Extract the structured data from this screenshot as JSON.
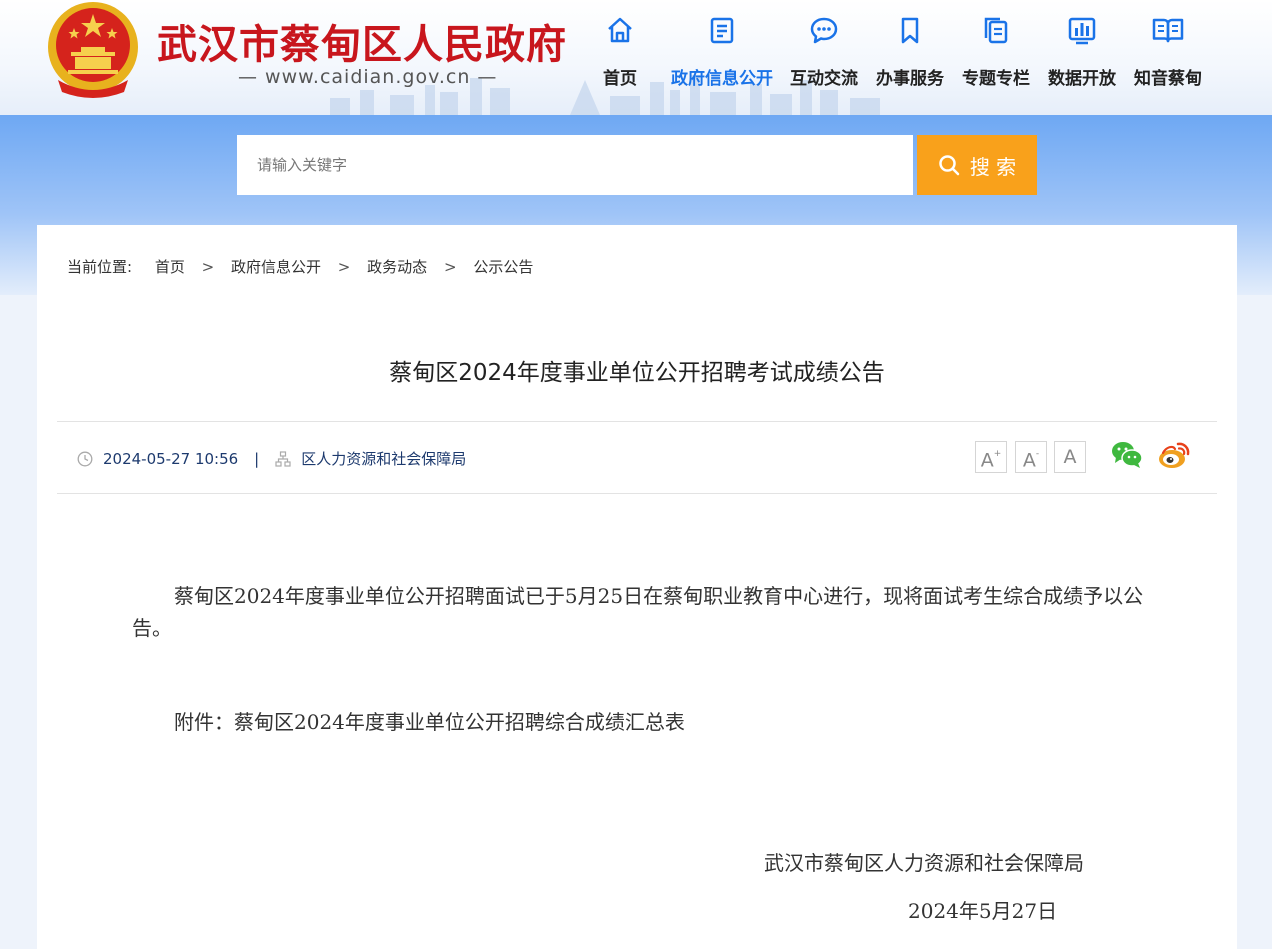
{
  "header": {
    "site_title": "武汉市蔡甸区人民政府",
    "site_url": "— www.caidian.gov.cn —"
  },
  "nav": {
    "items": [
      {
        "label": "首页",
        "icon": "home-icon"
      },
      {
        "label": "政府信息公开",
        "icon": "document-icon",
        "active": true
      },
      {
        "label": "互动交流",
        "icon": "chat-bubble-icon"
      },
      {
        "label": "办事服务",
        "icon": "bookmark-icon"
      },
      {
        "label": "专题专栏",
        "icon": "stacked-pages-icon"
      },
      {
        "label": "数据开放",
        "icon": "bar-chart-icon"
      },
      {
        "label": "知音蔡甸",
        "icon": "open-book-icon"
      }
    ],
    "active_color": "#1a73e8"
  },
  "search": {
    "placeholder": "请输入关键字",
    "button_label": "搜 索",
    "button_color": "#f9a11b"
  },
  "breadcrumb": {
    "lead": "当前位置:",
    "items": [
      "首页",
      "政务动态",
      "政府信息公开",
      "公示公告"
    ],
    "separator": ">"
  },
  "article": {
    "title": "蔡甸区2024年度事业单位公开招聘考试成绩公告",
    "datetime": "2024-05-27 10:56",
    "source": "区人力资源和社会保障局",
    "paragraph_1": "蔡甸区2024年度事业单位公开招聘面试已于5月25日在蔡甸职业教育中心进行，现将面试考生综合成绩予以公告。",
    "paragraph_2": "附件：蔡甸区2024年度事业单位公开招聘综合成绩汇总表",
    "signature_org": "武汉市蔡甸区人力资源和社会保障局",
    "signature_date": "2024年5月27日"
  },
  "font_size_controls": {
    "increase": "A",
    "decrease": "A",
    "reset": "A",
    "increase_mark": "+",
    "decrease_mark": "-"
  },
  "share": {
    "wechat_icon": "wechat-icon",
    "weibo_icon": "weibo-icon"
  }
}
